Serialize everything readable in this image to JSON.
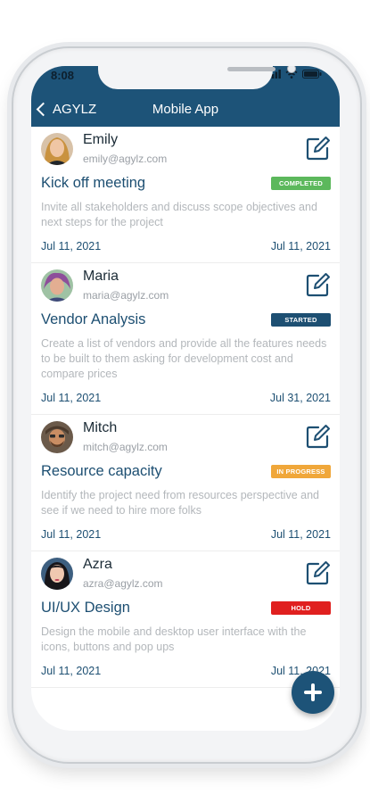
{
  "status_bar": {
    "time": "8:08"
  },
  "header": {
    "back_label": "AGYLZ",
    "title": "Mobile App"
  },
  "colors": {
    "brand": "#1d5378",
    "completed": "#5cb85c",
    "started": "#1d4f72",
    "in_progress": "#f0a73a",
    "hold": "#e0201f"
  },
  "tasks": [
    {
      "name": "Emily",
      "email": "emily@agylz.com",
      "title": "Kick off meeting",
      "status": "COMPLETED",
      "description": "Invite all stakeholders and discuss scope objectives and next steps for the project",
      "start": "Jul 11, 2021",
      "end": "Jul 11, 2021"
    },
    {
      "name": "Maria",
      "email": "maria@agylz.com",
      "title": "Vendor Analysis",
      "status": "STARTED",
      "description": "Create a list of vendors and provide all the features needs to be built to them asking for development cost and compare prices",
      "start": "Jul 11, 2021",
      "end": "Jul 31, 2021"
    },
    {
      "name": "Mitch",
      "email": "mitch@agylz.com",
      "title": "Resource capacity",
      "status": "IN PROGRESS",
      "description": "Identify the project need from resources perspective and see if we need to hire more folks",
      "start": "Jul 11, 2021",
      "end": "Jul 11, 2021"
    },
    {
      "name": "Azra",
      "email": "azra@agylz.com",
      "title": "UI/UX Design",
      "status": "HOLD",
      "description": "Design the mobile and desktop user interface with the icons, buttons and pop ups",
      "start": "Jul 11, 2021",
      "end": "Jul 11, 2021"
    }
  ],
  "icons": {
    "edit": "edit-icon",
    "add": "plus-icon",
    "back": "chevron-left-icon"
  }
}
